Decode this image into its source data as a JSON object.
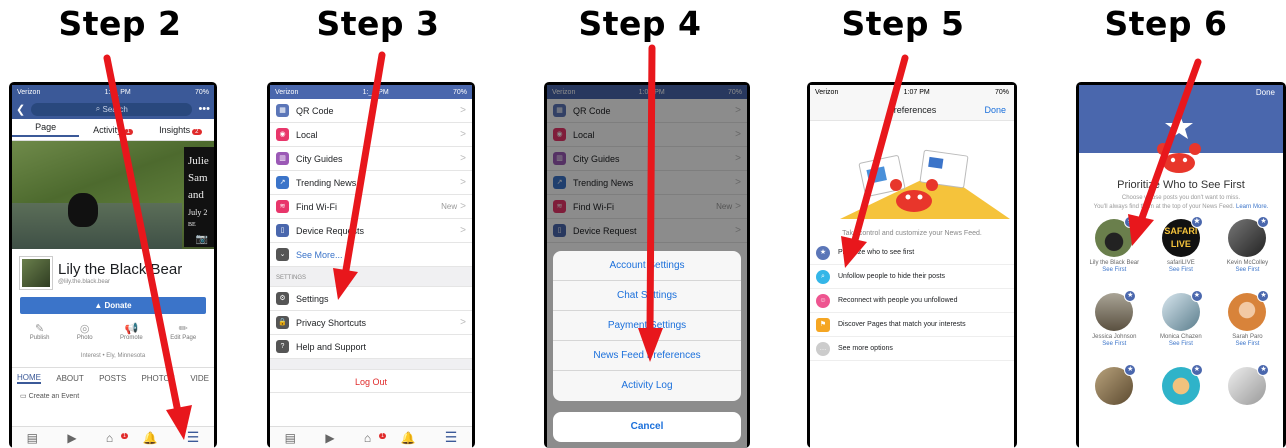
{
  "steps": [
    {
      "title": "Step 2"
    },
    {
      "title": "Step 3"
    },
    {
      "title": "Step 4"
    },
    {
      "title": "Step 5"
    },
    {
      "title": "Step 6"
    }
  ],
  "status": {
    "carrier": "Verizon",
    "time2": "1:0_ PM",
    "time3": "1:_6 PM",
    "time4": "1:0_ PM",
    "time5": "1:07 PM",
    "battery": "70%"
  },
  "s2": {
    "search": "Search",
    "tabs": [
      "Page",
      "Activity",
      "Insights"
    ],
    "badges": [
      "1",
      "2"
    ],
    "cover_text": [
      "Julie",
      "Sam",
      "and",
      "July 2"
    ],
    "cover_small": "BE",
    "page_name": "Lily the Black Bear",
    "handle": "@lily.the.black.bear",
    "donate": "Donate",
    "actions": [
      "Publish",
      "Photo",
      "Promote",
      "Edit Page"
    ],
    "interest": "Interest • Ely, Minnesota",
    "ptabs": [
      "HOME",
      "ABOUT",
      "POSTS",
      "PHOTOS",
      "VIDE"
    ],
    "event": "Create an Event",
    "tab_badge": "1"
  },
  "s3": {
    "items": [
      "QR Code",
      "Local",
      "City Guides",
      "Trending News",
      "Find Wi-Fi",
      "Device Requests",
      "See More..."
    ],
    "new": "New",
    "section": "SETTINGS",
    "settings": [
      "Settings",
      "Privacy Shortcuts",
      "Help and Support"
    ],
    "logout": "Log Out"
  },
  "s4": {
    "items": [
      "QR Code",
      "Local",
      "City Guides",
      "Trending News",
      "Find Wi-Fi",
      "Device Request"
    ],
    "new": "New",
    "sheet": [
      "Account Settings",
      "Chat Settings",
      "Payment Settings",
      "News Feed Preferences",
      "Activity Log"
    ],
    "cancel": "Cancel"
  },
  "s5": {
    "title": "Preferences",
    "done": "Done",
    "tagline": "Take control and customize your News Feed.",
    "options": [
      "Prioritize who to see first",
      "Unfollow people to hide their posts",
      "Reconnect with people you unfollowed",
      "Discover Pages that match your interests",
      "See more options"
    ]
  },
  "s6": {
    "done": "Done",
    "title": "Prioritize Who to See First",
    "desc1": "Choose whose posts you don't want to miss.",
    "desc2": "You'll always find them at the top of your News Feed.",
    "learn": "Learn More.",
    "people": [
      {
        "name": "Lily the Black Bear",
        "sf": "See First"
      },
      {
        "name": "safariLIVE",
        "sf": "See First"
      },
      {
        "name": "Kevin McColley",
        "sf": "See First"
      },
      {
        "name": "Jessica Johnson",
        "sf": "See First"
      },
      {
        "name": "Monica Chazen",
        "sf": "See First"
      },
      {
        "name": "Sarah Paro",
        "sf": "See First"
      }
    ]
  },
  "colors": {
    "fb_blue": "#3b5998",
    "arrow": "#e8171c",
    "link": "#1a6fdb"
  }
}
